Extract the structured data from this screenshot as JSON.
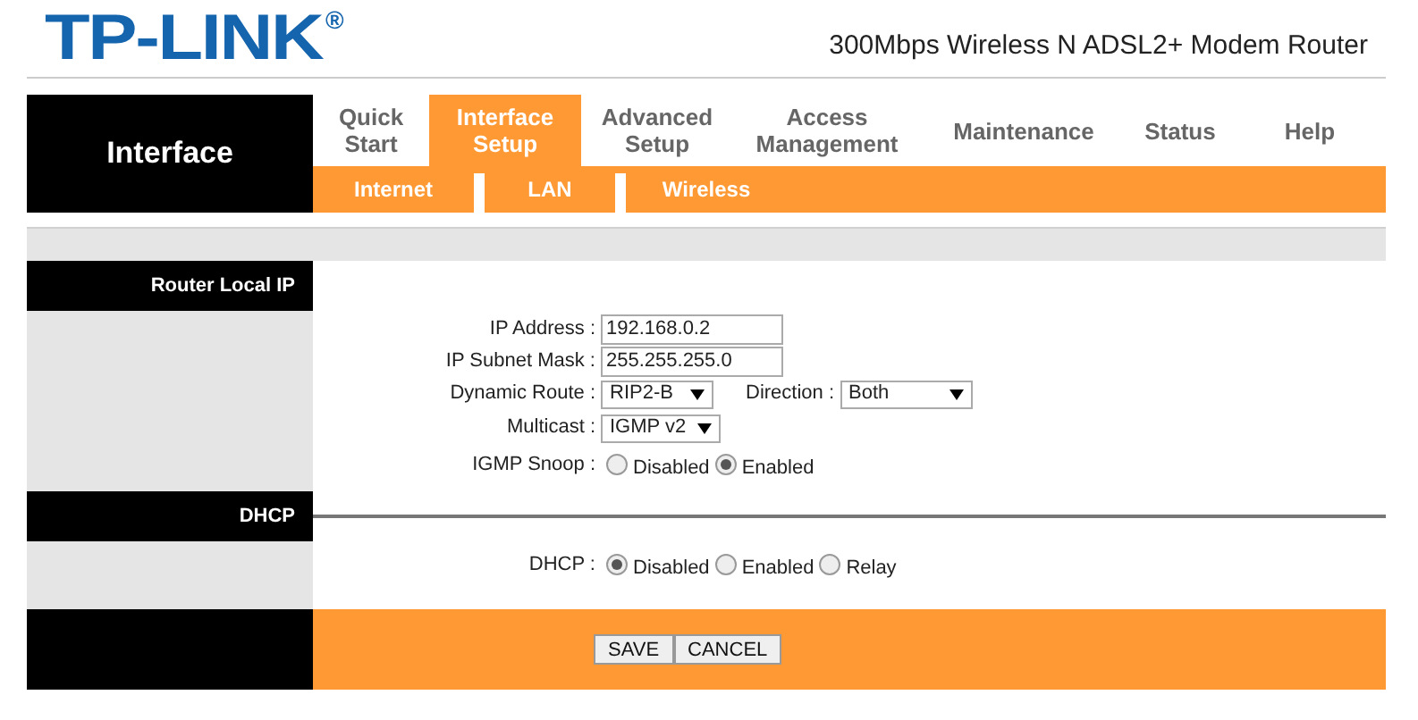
{
  "brand": {
    "logo": "TP-LINK",
    "registered": "®",
    "model": "300Mbps Wireless N ADSL2+ Modem Router"
  },
  "page_title": "Interface",
  "nav": [
    {
      "lines": [
        "Quick",
        "Start"
      ],
      "selected": false
    },
    {
      "lines": [
        "Interface",
        "Setup"
      ],
      "selected": true
    },
    {
      "lines": [
        "Advanced",
        "Setup"
      ],
      "selected": false
    },
    {
      "lines": [
        "Access",
        "Management"
      ],
      "selected": false
    },
    {
      "lines": [
        "Maintenance"
      ],
      "selected": false
    },
    {
      "lines": [
        "Status"
      ],
      "selected": false
    },
    {
      "lines": [
        "Help"
      ],
      "selected": false
    }
  ],
  "subnav": [
    "Internet",
    "LAN",
    "Wireless"
  ],
  "sections": [
    {
      "title": "Router Local IP",
      "rows": [
        {
          "kind": "text",
          "label": "IP Address :",
          "value": "192.168.0.2"
        },
        {
          "kind": "text",
          "label": "IP Subnet Mask :",
          "value": "255.255.255.0"
        },
        {
          "kind": "selects",
          "items": [
            {
              "label": "Dynamic Route :",
              "value": "RIP2-B"
            },
            {
              "label": "Direction :",
              "value": "Both"
            }
          ]
        },
        {
          "kind": "selects",
          "items": [
            {
              "label": "Multicast :",
              "value": "IGMP v2"
            }
          ]
        },
        {
          "kind": "radio",
          "label": "IGMP Snoop :",
          "options": [
            {
              "label": "Disabled",
              "selected": false
            },
            {
              "label": "Enabled",
              "selected": true
            }
          ]
        }
      ]
    },
    {
      "title": "DHCP",
      "rows": [
        {
          "kind": "radio",
          "label": "DHCP :",
          "options": [
            {
              "label": "Disabled",
              "selected": true
            },
            {
              "label": "Enabled",
              "selected": false
            },
            {
              "label": "Relay",
              "selected": false
            }
          ]
        }
      ]
    }
  ],
  "buttons": [
    "SAVE",
    "CANCEL"
  ]
}
